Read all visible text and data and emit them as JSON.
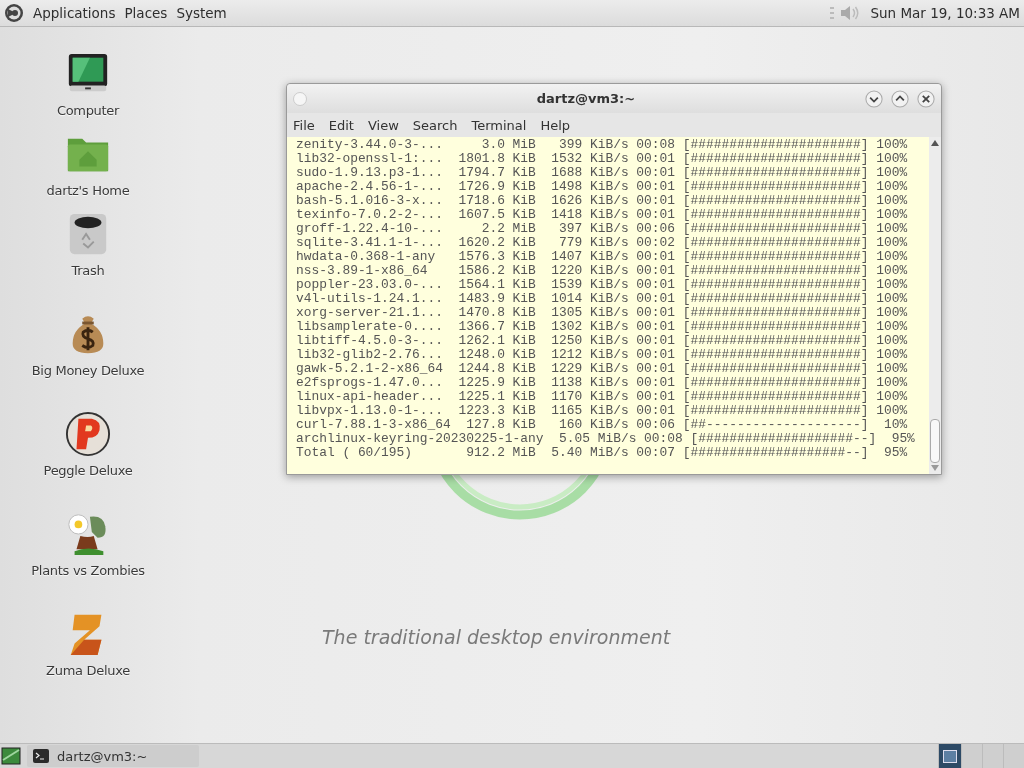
{
  "top_panel": {
    "menus": [
      "Applications",
      "Places",
      "System"
    ],
    "clock": "Sun Mar 19, 10:33 AM"
  },
  "desktop_icons": [
    {
      "label": "Computer",
      "kind": "computer"
    },
    {
      "label": "dartz's Home",
      "kind": "home"
    },
    {
      "label": "Trash",
      "kind": "trash"
    },
    {
      "label": "Big Money Deluxe",
      "kind": "money"
    },
    {
      "label": "Peggle Deluxe",
      "kind": "peggle"
    },
    {
      "label": "Plants vs Zombies",
      "kind": "plants"
    },
    {
      "label": "Zuma Deluxe",
      "kind": "zuma"
    }
  ],
  "wallpaper": {
    "tagline": "The traditional desktop environment"
  },
  "terminal": {
    "title": "dartz@vm3:~",
    "menus": [
      "File",
      "Edit",
      "View",
      "Search",
      "Terminal",
      "Help"
    ],
    "rows": [
      {
        "name": "zenity-3.44.0-3-...",
        "size": "3.0 MiB",
        "rate": "399 KiB/s",
        "time": "00:08",
        "bar": "[######################]",
        "percent": "100%"
      },
      {
        "name": "lib32-openssl-1:...",
        "size": "1801.8 KiB",
        "rate": "1532 KiB/s",
        "time": "00:01",
        "bar": "[######################]",
        "percent": "100%"
      },
      {
        "name": "sudo-1.9.13.p3-1...",
        "size": "1794.7 KiB",
        "rate": "1688 KiB/s",
        "time": "00:01",
        "bar": "[######################]",
        "percent": "100%"
      },
      {
        "name": "apache-2.4.56-1-...",
        "size": "1726.9 KiB",
        "rate": "1498 KiB/s",
        "time": "00:01",
        "bar": "[######################]",
        "percent": "100%"
      },
      {
        "name": "bash-5.1.016-3-x...",
        "size": "1718.6 KiB",
        "rate": "1626 KiB/s",
        "time": "00:01",
        "bar": "[######################]",
        "percent": "100%"
      },
      {
        "name": "texinfo-7.0.2-2-...",
        "size": "1607.5 KiB",
        "rate": "1418 KiB/s",
        "time": "00:01",
        "bar": "[######################]",
        "percent": "100%"
      },
      {
        "name": "groff-1.22.4-10-...",
        "size": "2.2 MiB",
        "rate": "397 KiB/s",
        "time": "00:06",
        "bar": "[######################]",
        "percent": "100%"
      },
      {
        "name": "sqlite-3.41.1-1-...",
        "size": "1620.2 KiB",
        "rate": "779 KiB/s",
        "time": "00:02",
        "bar": "[######################]",
        "percent": "100%"
      },
      {
        "name": "hwdata-0.368-1-any",
        "size": "1576.3 KiB",
        "rate": "1407 KiB/s",
        "time": "00:01",
        "bar": "[######################]",
        "percent": "100%"
      },
      {
        "name": "nss-3.89-1-x86_64",
        "size": "1586.2 KiB",
        "rate": "1220 KiB/s",
        "time": "00:01",
        "bar": "[######################]",
        "percent": "100%"
      },
      {
        "name": "poppler-23.03.0-...",
        "size": "1564.1 KiB",
        "rate": "1539 KiB/s",
        "time": "00:01",
        "bar": "[######################]",
        "percent": "100%"
      },
      {
        "name": "v4l-utils-1.24.1...",
        "size": "1483.9 KiB",
        "rate": "1014 KiB/s",
        "time": "00:01",
        "bar": "[######################]",
        "percent": "100%"
      },
      {
        "name": "xorg-server-21.1...",
        "size": "1470.8 KiB",
        "rate": "1305 KiB/s",
        "time": "00:01",
        "bar": "[######################]",
        "percent": "100%"
      },
      {
        "name": "libsamplerate-0....",
        "size": "1366.7 KiB",
        "rate": "1302 KiB/s",
        "time": "00:01",
        "bar": "[######################]",
        "percent": "100%"
      },
      {
        "name": "libtiff-4.5.0-3-...",
        "size": "1262.1 KiB",
        "rate": "1250 KiB/s",
        "time": "00:01",
        "bar": "[######################]",
        "percent": "100%"
      },
      {
        "name": "lib32-glib2-2.76...",
        "size": "1248.0 KiB",
        "rate": "1212 KiB/s",
        "time": "00:01",
        "bar": "[######################]",
        "percent": "100%"
      },
      {
        "name": "gawk-5.2.1-2-x86_64",
        "size": "1244.8 KiB",
        "rate": "1229 KiB/s",
        "time": "00:01",
        "bar": "[######################]",
        "percent": "100%"
      },
      {
        "name": "e2fsprogs-1.47.0...",
        "size": "1225.9 KiB",
        "rate": "1138 KiB/s",
        "time": "00:01",
        "bar": "[######################]",
        "percent": "100%"
      },
      {
        "name": "linux-api-header...",
        "size": "1225.1 KiB",
        "rate": "1170 KiB/s",
        "time": "00:01",
        "bar": "[######################]",
        "percent": "100%"
      },
      {
        "name": "libvpx-1.13.0-1-...",
        "size": "1223.3 KiB",
        "rate": "1165 KiB/s",
        "time": "00:01",
        "bar": "[######################]",
        "percent": "100%"
      },
      {
        "name": "curl-7.88.1-3-x86_64",
        "size": "127.8 KiB",
        "rate": "160 KiB/s",
        "time": "00:06",
        "bar": "[##--------------------]",
        "percent": "10%"
      },
      {
        "name": "archlinux-keyring-20230225-1-any",
        "rate": "5.05 MiB/s",
        "time": "00:08",
        "bar": "[####################--]",
        "percent": "95%"
      },
      {
        "name": "Total ( 60/195)",
        "size": "912.2 MiB",
        "rate": "5.40 MiB/s",
        "time": "00:07",
        "bar": "[####################--]",
        "percent": "95%"
      }
    ]
  },
  "taskbar": {
    "tasks": [
      {
        "label": "dartz@vm3:~",
        "selected": false
      }
    ],
    "workspaces": [
      {
        "selected": true
      },
      {
        "selected": false
      },
      {
        "selected": false
      },
      {
        "selected": false
      }
    ]
  }
}
